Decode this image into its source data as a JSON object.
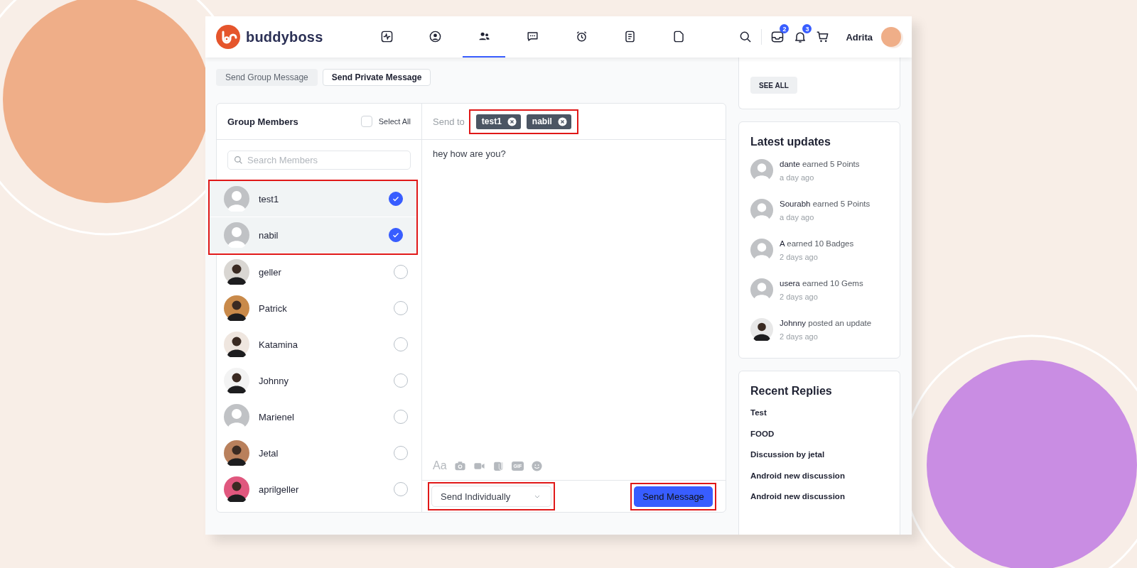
{
  "brand": {
    "name": "buddyboss"
  },
  "nav": [
    {
      "kind": "activity",
      "selected": false
    },
    {
      "kind": "profile",
      "selected": false
    },
    {
      "kind": "members",
      "selected": true
    },
    {
      "kind": "messages",
      "selected": false
    },
    {
      "kind": "alarm",
      "selected": false
    },
    {
      "kind": "document",
      "selected": false
    },
    {
      "kind": "page",
      "selected": false
    }
  ],
  "header_actions": [
    {
      "kind": "search"
    },
    {
      "kind": "inbox",
      "badge": "2"
    },
    {
      "kind": "bell",
      "badge": "3"
    },
    {
      "kind": "cart"
    }
  ],
  "user": {
    "name": "Adrita"
  },
  "message_tabs": [
    {
      "label": "Send Group Message",
      "selected": false
    },
    {
      "label": "Send Private Message",
      "selected": true
    }
  ],
  "members_panel": {
    "title": "Group Members",
    "select_all": {
      "label": "Select All",
      "checked": false
    },
    "search": {
      "placeholder": "Search Members"
    },
    "members": [
      {
        "name": "test1",
        "has_photo": false,
        "selected": true,
        "highlighted": true
      },
      {
        "name": "nabil",
        "has_photo": false,
        "selected": true,
        "highlighted": true
      },
      {
        "name": "geller",
        "has_photo": true,
        "color": "#d9d6d2",
        "selected": false,
        "highlighted": false
      },
      {
        "name": "Patrick",
        "has_photo": true,
        "color": "#c98a4a",
        "selected": false,
        "highlighted": false
      },
      {
        "name": "Katamina",
        "has_photo": true,
        "color": "#efe6df",
        "selected": false,
        "highlighted": false
      },
      {
        "name": "Johnny",
        "has_photo": true,
        "color": "#f3f3f3",
        "selected": false,
        "highlighted": false
      },
      {
        "name": "Marienel",
        "has_photo": false,
        "selected": false,
        "highlighted": false
      },
      {
        "name": "Jetal",
        "has_photo": true,
        "color": "#b9805c",
        "selected": false,
        "highlighted": false
      },
      {
        "name": "aprilgeller",
        "has_photo": true,
        "color": "#e0577e",
        "selected": false,
        "highlighted": false
      }
    ]
  },
  "composer": {
    "send_to_label": "Send to",
    "recipients_highlighted": true,
    "recipients": [
      {
        "name": "test1"
      },
      {
        "name": "nabil"
      }
    ],
    "message": "hey how are you?",
    "tools": [
      {
        "kind": "format",
        "label": "Aa"
      },
      {
        "kind": "camera"
      },
      {
        "kind": "video"
      },
      {
        "kind": "attachment"
      },
      {
        "kind": "gif",
        "label": "GIF"
      },
      {
        "kind": "emoji"
      }
    ],
    "send_mode": {
      "value": "Send Individually",
      "highlighted": true
    },
    "send_button": {
      "label": "Send Message",
      "highlighted": true
    }
  },
  "sidebar": {
    "see_all": "SEE ALL",
    "latest_updates": {
      "title": "Latest updates",
      "items": [
        {
          "text": "**dante** earned 5 Points",
          "time": "a day ago",
          "has_photo": false
        },
        {
          "text": "**Sourabh** earned 5 Points",
          "time": "a day ago",
          "has_photo": false
        },
        {
          "text": "**A** earned 10 Badges",
          "time": "2 days ago",
          "has_photo": false
        },
        {
          "text": "**usera** earned 10 Gems",
          "time": "2 days ago",
          "has_photo": false
        },
        {
          "text": "**Johnny** posted an update",
          "time": "2 days ago",
          "has_photo": true,
          "color": "#e8e8e8"
        }
      ]
    },
    "recent_replies": {
      "title": "Recent Replies",
      "items": [
        "Test",
        "FOOD",
        "Discussion by jetal",
        "Android new discussion",
        "Android new discussion"
      ]
    }
  }
}
